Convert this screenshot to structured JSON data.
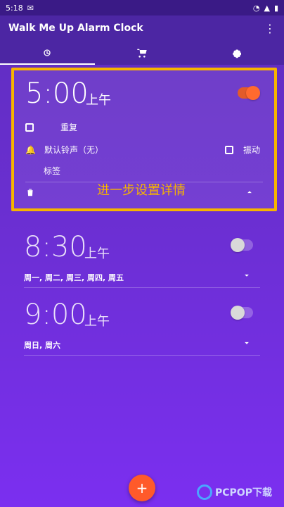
{
  "status_bar": {
    "time": "5:18",
    "left_icon": "gmail-icon",
    "right_icons": [
      "wifi-icon",
      "signal-icon",
      "battery-icon"
    ]
  },
  "app": {
    "title": "Walk Me Up Alarm Clock",
    "menu_icon": "more-vert-icon"
  },
  "tabs": [
    {
      "name": "alarms",
      "icon": "alarm-icon",
      "active": true
    },
    {
      "name": "store",
      "icon": "cart-icon",
      "active": false
    },
    {
      "name": "settings",
      "icon": "gear-icon",
      "active": false
    }
  ],
  "alarms": [
    {
      "time": "5:00",
      "ampm": "上午",
      "enabled": true,
      "expanded": true,
      "repeat_label": "重复",
      "ringtone_label": "默认铃声（无）",
      "vibrate_label": "振动",
      "tag_label": "标签",
      "hint_label": "进一步设置详情"
    },
    {
      "time": "8:30",
      "ampm": "上午",
      "enabled": false,
      "days": "周一, 周二, 周三, 周四, 周五"
    },
    {
      "time": "9:00",
      "ampm": "上午",
      "enabled": false,
      "days": "周日, 周六"
    }
  ],
  "fab": {
    "label": "+"
  },
  "watermark": {
    "text": "PCPOP下载"
  },
  "colors": {
    "accent": "#ff5a2a",
    "highlight": "#f7b400",
    "app_bar": "#4c26a3"
  }
}
